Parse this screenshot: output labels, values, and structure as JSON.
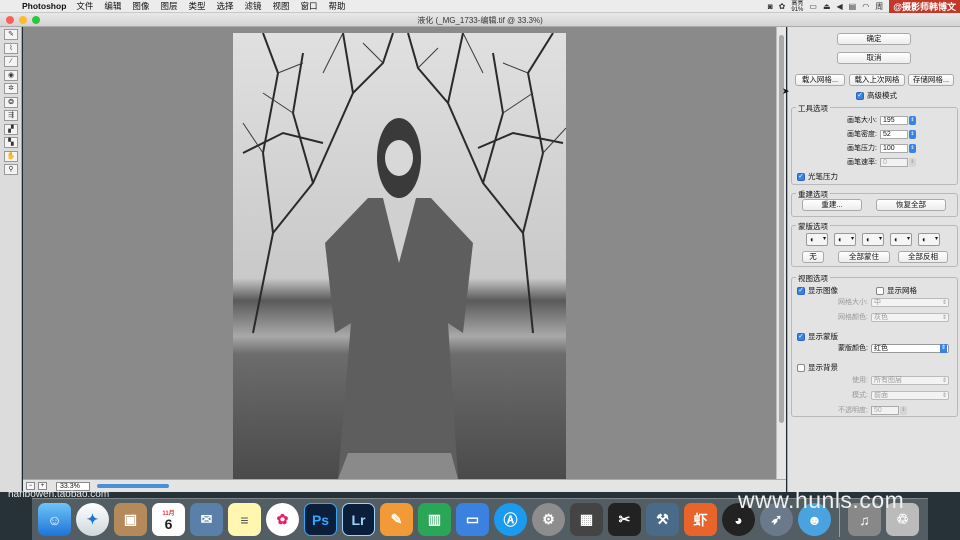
{
  "menubar": {
    "app_name": "Photoshop",
    "items": [
      "文件",
      "编辑",
      "图像",
      "图层",
      "类型",
      "选择",
      "滤镜",
      "视图",
      "窗口",
      "帮助"
    ],
    "battery_top": "高亮",
    "battery_pct": "91%",
    "day": "周",
    "watermark": "@摄影师韩博文"
  },
  "window": {
    "title": "液化 (_MG_1733-编辑.tif @ 33.3%)"
  },
  "tools": [
    {
      "name": "forward-warp-tool-icon",
      "glyph": "✎"
    },
    {
      "name": "reconstruct-tool-icon",
      "glyph": "⌇"
    },
    {
      "name": "smooth-tool-icon",
      "glyph": "∕"
    },
    {
      "name": "twirl-clockwise-tool-icon",
      "glyph": "◉"
    },
    {
      "name": "pucker-tool-icon",
      "glyph": "✲"
    },
    {
      "name": "bloat-tool-icon",
      "glyph": "❂"
    },
    {
      "name": "push-left-tool-icon",
      "glyph": "⇶"
    },
    {
      "name": "freeze-mask-tool-icon",
      "glyph": "▞"
    },
    {
      "name": "thaw-mask-tool-icon",
      "glyph": "▚"
    },
    {
      "name": "hand-tool-icon",
      "glyph": "✋"
    },
    {
      "name": "zoom-tool-icon",
      "glyph": "⚲"
    }
  ],
  "statusbar": {
    "zoom": "33.3%"
  },
  "panel": {
    "ok": "确定",
    "cancel": "取消",
    "load_mesh": "载入网格...",
    "load_last_mesh": "载入上次网格",
    "save_mesh": "存储网格...",
    "advanced_mode": "高级模式",
    "tool_options": {
      "title": "工具选项",
      "brush_size_label": "画笔大小:",
      "brush_size": "195",
      "brush_density_label": "画笔密度:",
      "brush_density": "52",
      "brush_pressure_label": "画笔压力:",
      "brush_pressure": "100",
      "brush_rate_label": "画笔速率:",
      "brush_rate": "0",
      "stylus_pressure": "光笔压力"
    },
    "reconstruct": {
      "title": "重建选项",
      "reconstruct_btn": "重建...",
      "restore_all_btn": "恢复全部"
    },
    "mask": {
      "title": "蒙版选项",
      "none_btn": "无",
      "mask_all_btn": "全部蒙住",
      "invert_all_btn": "全部反相"
    },
    "view": {
      "title": "视图选项",
      "show_image": "显示图像",
      "show_mesh": "显示网格",
      "mesh_size_label": "网格大小:",
      "mesh_size": "中",
      "mesh_color_label": "网格颜色:",
      "mesh_color": "灰色",
      "show_mask": "显示蒙版",
      "mask_color_label": "蒙版颜色:",
      "mask_color": "红色",
      "show_backdrop": "显示背景",
      "use_label": "使用:",
      "use_value": "所有图层",
      "mode_label": "模式:",
      "mode_value": "前面",
      "opacity_label": "不透明度:",
      "opacity_value": "50"
    }
  },
  "dock": {
    "calendar_month": "11月",
    "calendar_day": "6",
    "ps_label": "Ps",
    "lr_label": "Lr",
    "xia_label": "虾"
  },
  "watermarks": {
    "left": "hanbowen.taobao.com",
    "right": "www.hunls.com"
  },
  "colors": {
    "accent": "#3b82e0",
    "canvas_bg": "#8a8a8a",
    "watermark_bg": "#c0392b"
  }
}
